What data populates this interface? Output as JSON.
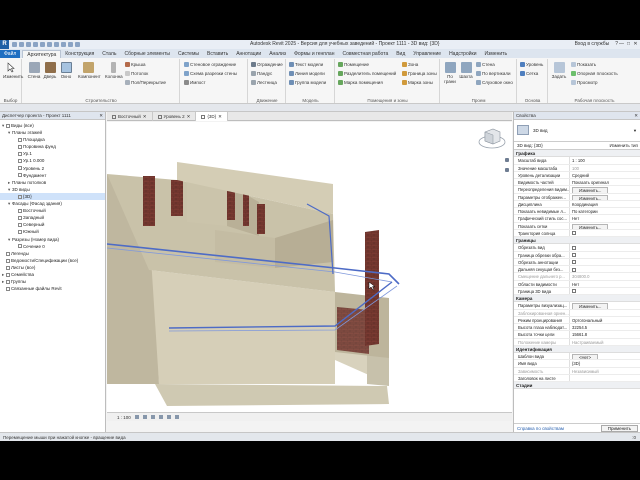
{
  "window": {
    "app_logo": "R",
    "title": "Autodesk Revit 2025 - Версия для учебных заведений - Проект 1111 - 3D вид: {3D}",
    "sign_in": "Вход в службы",
    "help": "?",
    "minimize": "—",
    "maximize": "□",
    "close": "✕"
  },
  "ribbon_tabs": [
    "Файл",
    "Архитектура",
    "Конструкция",
    "Сталь",
    "Сборные элементы",
    "Системы",
    "Вставить",
    "Аннотации",
    "Анализ",
    "Формы и генплан",
    "Совместная работа",
    "Вид",
    "Управление",
    "Надстройки",
    "Изменить"
  ],
  "active_tab_index": 1,
  "ribbon": {
    "select": {
      "modify": "Изменить",
      "panel": "Выбор"
    },
    "build": {
      "wall": "Стена",
      "door": "Дверь",
      "window": "Окно",
      "component": "Компонент",
      "column": "Колонна",
      "roof": "Крыша",
      "ceiling": "Потолок",
      "floor": "Пол/Перекрытие",
      "curtain_system": "Стеновое ограждение",
      "curtain_grid": "Схема разрезки стены",
      "mullion": "Импост",
      "railing": "Ограждение",
      "ramp": "Пандус",
      "stair": "Лестница",
      "panel": "Строительство",
      "panel2": "Движение"
    },
    "model": {
      "model_text": "Текст модели",
      "model_line": "Линия модели",
      "model_group": "Группа модели",
      "panel": "Модель"
    },
    "room": {
      "room": "Помещение",
      "room_separator": "Разделитель помещений",
      "tag_room": "Марка помещения",
      "area": "Зона",
      "area_boundary": "Граница зоны",
      "tag_area": "Марка зоны",
      "panel": "Помещения и зоны"
    },
    "opening": {
      "by_face": "По грани",
      "shaft": "Шахта",
      "wall_op": "Стена",
      "vertical": "По вертикали",
      "dormer": "Слуховое окно",
      "panel": "Проем"
    },
    "datum": {
      "level": "Уровень",
      "grid": "Сетка",
      "panel": "Основа"
    },
    "workplane": {
      "set": "Задать",
      "show": "Показать",
      "ref_plane": "Опорная плоскость",
      "viewer": "Просмотр",
      "panel": "Рабочая плоскость"
    }
  },
  "project_browser": {
    "title": "Диспетчер проекта - Проект 1111",
    "items": [
      {
        "label": "Виды (все)",
        "depth": 0,
        "tw": "▾",
        "cb": true
      },
      {
        "label": "Планы этажей",
        "depth": 1,
        "tw": "▾"
      },
      {
        "label": "Площадка",
        "depth": 2,
        "cb": true
      },
      {
        "label": "Поровина фунд",
        "depth": 2,
        "cb": true
      },
      {
        "label": "Ур.1",
        "depth": 2,
        "cb": true
      },
      {
        "label": "Ур.1 0.000",
        "depth": 2,
        "cb": true
      },
      {
        "label": "Уровень 2",
        "depth": 2,
        "cb": true
      },
      {
        "label": "Фундамент",
        "depth": 2,
        "cb": true
      },
      {
        "label": "Планы потолков",
        "depth": 1,
        "tw": "▸"
      },
      {
        "label": "3D виды",
        "depth": 1,
        "tw": "▾"
      },
      {
        "label": "{3D}",
        "depth": 2,
        "cb": true,
        "sel": true
      },
      {
        "label": "Фасады (Фасад здания)",
        "depth": 1,
        "tw": "▾"
      },
      {
        "label": "Восточный",
        "depth": 2,
        "cb": true
      },
      {
        "label": "Западный",
        "depth": 2,
        "cb": true
      },
      {
        "label": "Северный",
        "depth": 2,
        "cb": true
      },
      {
        "label": "Южный",
        "depth": 2,
        "cb": true
      },
      {
        "label": "Разрезы (Номер вида)",
        "depth": 1,
        "tw": "▾"
      },
      {
        "label": "Сечение 0",
        "depth": 2,
        "cb": true
      },
      {
        "label": "Легенды",
        "depth": 0,
        "cb": true
      },
      {
        "label": "Ведомости/Спецификации (все)",
        "depth": 0,
        "cb": true
      },
      {
        "label": "Листы (все)",
        "depth": 0,
        "cb": true
      },
      {
        "label": "Семейства",
        "depth": 0,
        "tw": "▸",
        "cb": true
      },
      {
        "label": "Группы",
        "depth": 0,
        "tw": "▸",
        "cb": true
      },
      {
        "label": "Связанные файлы Revit",
        "depth": 0,
        "cb": true
      }
    ]
  },
  "view_tabs": [
    {
      "label": "Восточный",
      "active": false
    },
    {
      "label": "Уровень 2",
      "active": false
    },
    {
      "label": "{3D}",
      "active": true
    }
  ],
  "view_cube": {
    "face": "СЛЕВА"
  },
  "view_control": {
    "scale": "1 : 100"
  },
  "properties": {
    "title": "Свойства",
    "type_name": "3D вид",
    "instance": "3D вид: {3D}",
    "edit_type": "Изменить тип",
    "groups": [
      {
        "name": "Графика",
        "rows": [
          {
            "k": "Масштаб вида",
            "v": "1 : 100",
            "kind": "input"
          },
          {
            "k": "Значение масштаба",
            "v": "100",
            "dim": true
          },
          {
            "k": "Уровень детализации",
            "v": "Средний"
          },
          {
            "k": "Видимость частей",
            "v": "Показать оригинал"
          },
          {
            "k": "Переопределения видим...",
            "v": "Изменить...",
            "kind": "button"
          },
          {
            "k": "Параметры отображен...",
            "v": "Изменить...",
            "kind": "button"
          },
          {
            "k": "Дисциплина",
            "v": "Координация"
          },
          {
            "k": "Показать невидимые л...",
            "v": "По категории"
          },
          {
            "k": "Графический стиль сос...",
            "v": "Нет"
          },
          {
            "k": "Показать сетки",
            "v": "Изменить...",
            "kind": "button"
          },
          {
            "k": "Траектория солнца",
            "v": "",
            "kind": "check"
          }
        ]
      },
      {
        "name": "Границы",
        "rows": [
          {
            "k": "Обрезать вид",
            "v": "",
            "kind": "check"
          },
          {
            "k": "Граница обрезки обра...",
            "v": "",
            "kind": "check"
          },
          {
            "k": "Обрезать аннотации",
            "v": "",
            "kind": "check"
          },
          {
            "k": "Дальняя секущая без...",
            "v": "",
            "kind": "check"
          },
          {
            "k": "Смещение дальнего р...",
            "v": "304800.0",
            "dim": true,
            "kdim": true
          },
          {
            "k": "Области видимости",
            "v": "Нет"
          },
          {
            "k": "Граница 3D вида",
            "v": "",
            "kind": "check"
          }
        ]
      },
      {
        "name": "Камера",
        "rows": [
          {
            "k": "Параметры визуализац...",
            "v": "Изменить...",
            "kind": "button"
          },
          {
            "k": "Заблокированная ориен...",
            "v": "",
            "kdim": true
          },
          {
            "k": "Режим проецирования",
            "v": "Ортогональный"
          },
          {
            "k": "Высота глаза наблюдат...",
            "v": "32254.5"
          },
          {
            "k": "Высота точки цели",
            "v": "15661.8"
          },
          {
            "k": "Положение камеры",
            "v": "Настраиваемый",
            "dim": true,
            "kdim": true
          }
        ]
      },
      {
        "name": "Идентификация",
        "rows": [
          {
            "k": "Шаблон вида",
            "v": "<Нет>",
            "kind": "button"
          },
          {
            "k": "Имя вида",
            "v": "{3D}"
          },
          {
            "k": "Зависимость",
            "v": "Независимый",
            "dim": true,
            "kdim": true
          },
          {
            "k": "Заголовок на листе",
            "v": ""
          }
        ]
      },
      {
        "name": "Стадии",
        "rows": []
      }
    ],
    "help_link": "Справка по свойствам",
    "apply": "Применить"
  },
  "status_bar": {
    "text": "Перемещение мыши при нажатой кнопке - вращение вида",
    "right": ":0"
  },
  "colors": {
    "file_tab": "#1f6fc2",
    "wall_cream": "#d9d4be",
    "brick": "#7b3b33",
    "selection_blue": "#5a79c9"
  }
}
